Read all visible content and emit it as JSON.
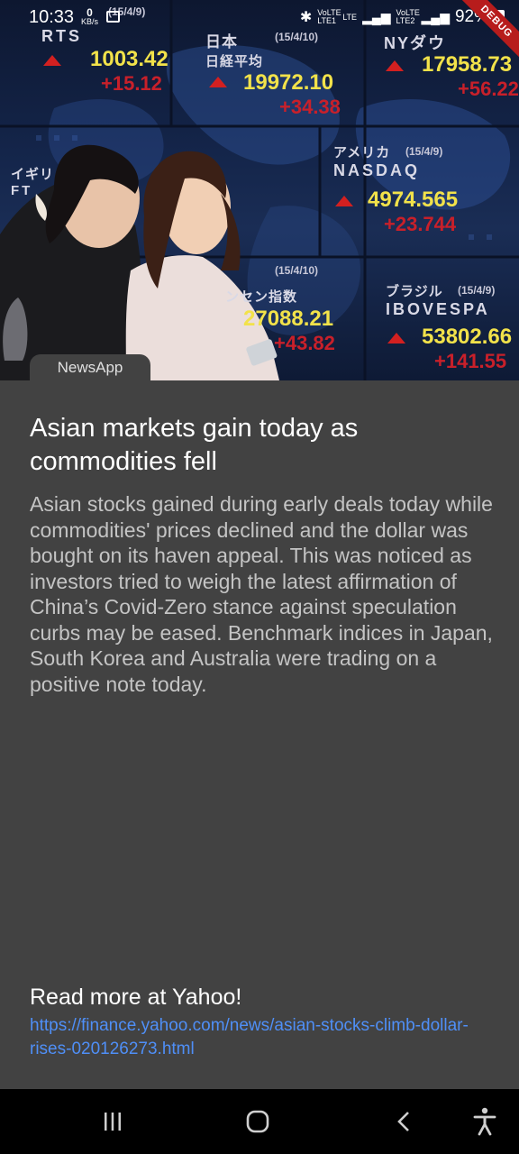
{
  "status_bar": {
    "time": "10:33",
    "data_rate_value": "0",
    "data_rate_unit": "KB/s",
    "network_1": "VoLTE LTE1",
    "network_2": "VoLTE LTE2",
    "network_type": "LTE",
    "battery": "92%",
    "debug_banner": "DEBUG"
  },
  "hero": {
    "tickers": [
      {
        "name": "RTS",
        "value": "1003.42",
        "change": "+15.12",
        "date": "(15/4/9)"
      },
      {
        "name": "日本",
        "subname": "日経平均",
        "value": "19972.10",
        "change": "+34.38",
        "date": "(15/4/10)"
      },
      {
        "name": "NYダウ",
        "value": "17958.73",
        "change": "+56.22"
      },
      {
        "name": "アメリカ",
        "subname": "NASDAQ",
        "value": "4974.565",
        "change": "+23.744",
        "date": "(15/4/9)"
      },
      {
        "name": "イギリ",
        "subname": "FT"
      },
      {
        "name": "ンセン指数",
        "value": "27088.21",
        "change": "+43.82",
        "date": "(15/4/10)"
      },
      {
        "name": "ブラジル",
        "subname": "IBOVESPA",
        "value": "53802.66",
        "change": "+141.55",
        "date": "(15/4/9)"
      }
    ]
  },
  "article": {
    "source": "NewsApp",
    "title": "Asian markets gain today as commodities fell",
    "description": "Asian stocks gained during early deals today while commodities' prices declined and the dollar was bought on its haven appeal. This was noticed as investors tried to weigh the latest affirmation of China’s Covid-Zero stance against speculation curbs may be eased. Benchmark indices in Japan, South Korea and Australia were trading on a positive note today.",
    "read_more_label": "Read more at Yahoo!",
    "url": "https://finance.yahoo.com/news/asian-stocks-climb-dollar-rises-020126273.html"
  },
  "nav": {
    "recents": "recents-icon",
    "home": "home-icon",
    "back": "back-icon",
    "accessibility": "accessibility-icon"
  },
  "colors": {
    "background": "#424242",
    "link": "#4f8ff7",
    "ticker_value": "#f2e24a",
    "ticker_change": "#c8202a"
  }
}
